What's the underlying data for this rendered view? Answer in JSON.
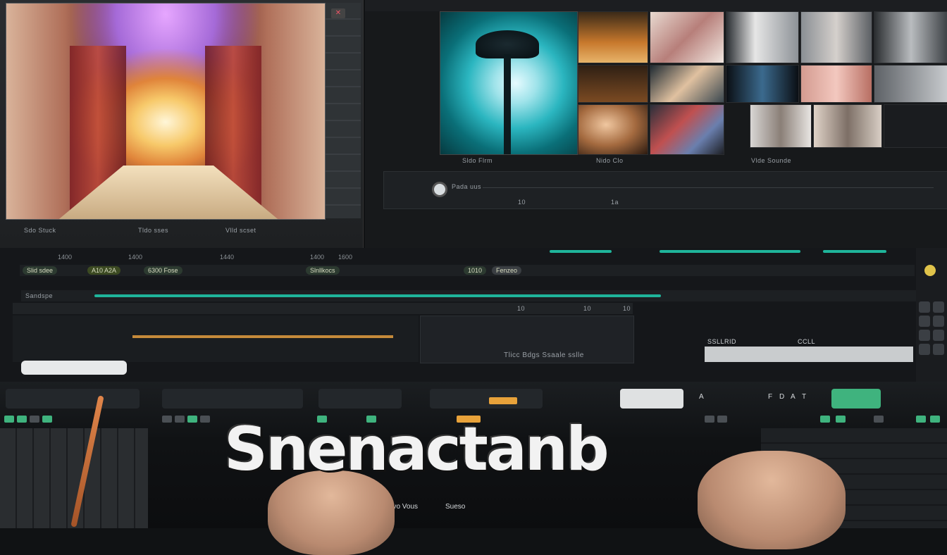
{
  "source_viewer": {
    "captions": [
      "Sdo Stuck",
      "Tldo sses",
      "Vlld scset"
    ],
    "timecodes": [
      "1400",
      "1400",
      "1440",
      "1400",
      "1600"
    ],
    "close_label": "✕"
  },
  "program": {
    "info_labels": [
      "Sldo Flrm",
      "Nido Clo",
      "Vlde Sounde"
    ],
    "preview_label": "Pada uus",
    "preview_marks": [
      "10",
      "1a"
    ]
  },
  "timeline": {
    "toolbar_chips": [
      "Slid sdee",
      "A10 A2A",
      "6300 Fose",
      "Slnllkocs",
      "1010",
      "Fenzeo"
    ],
    "track_label": "Sandspe",
    "track_marks": [
      "10",
      "10",
      "10"
    ],
    "clip_caption": "Tlicc Bdgs     Ssaale sslle",
    "status_labels": [
      "SSLLRID",
      "CCLL"
    ]
  },
  "console": {
    "brand_title": "Snenactanb",
    "deck_labels": [
      "Stvo Vous",
      "Sueso"
    ],
    "button_glyphs": [
      "A",
      "F",
      "D",
      "A",
      "T"
    ]
  },
  "colors": {
    "accent_teal": "#1fb59b",
    "accent_orange": "#e8a23a",
    "key_green": "#3fb37e",
    "panel_bg": "#15171a"
  }
}
